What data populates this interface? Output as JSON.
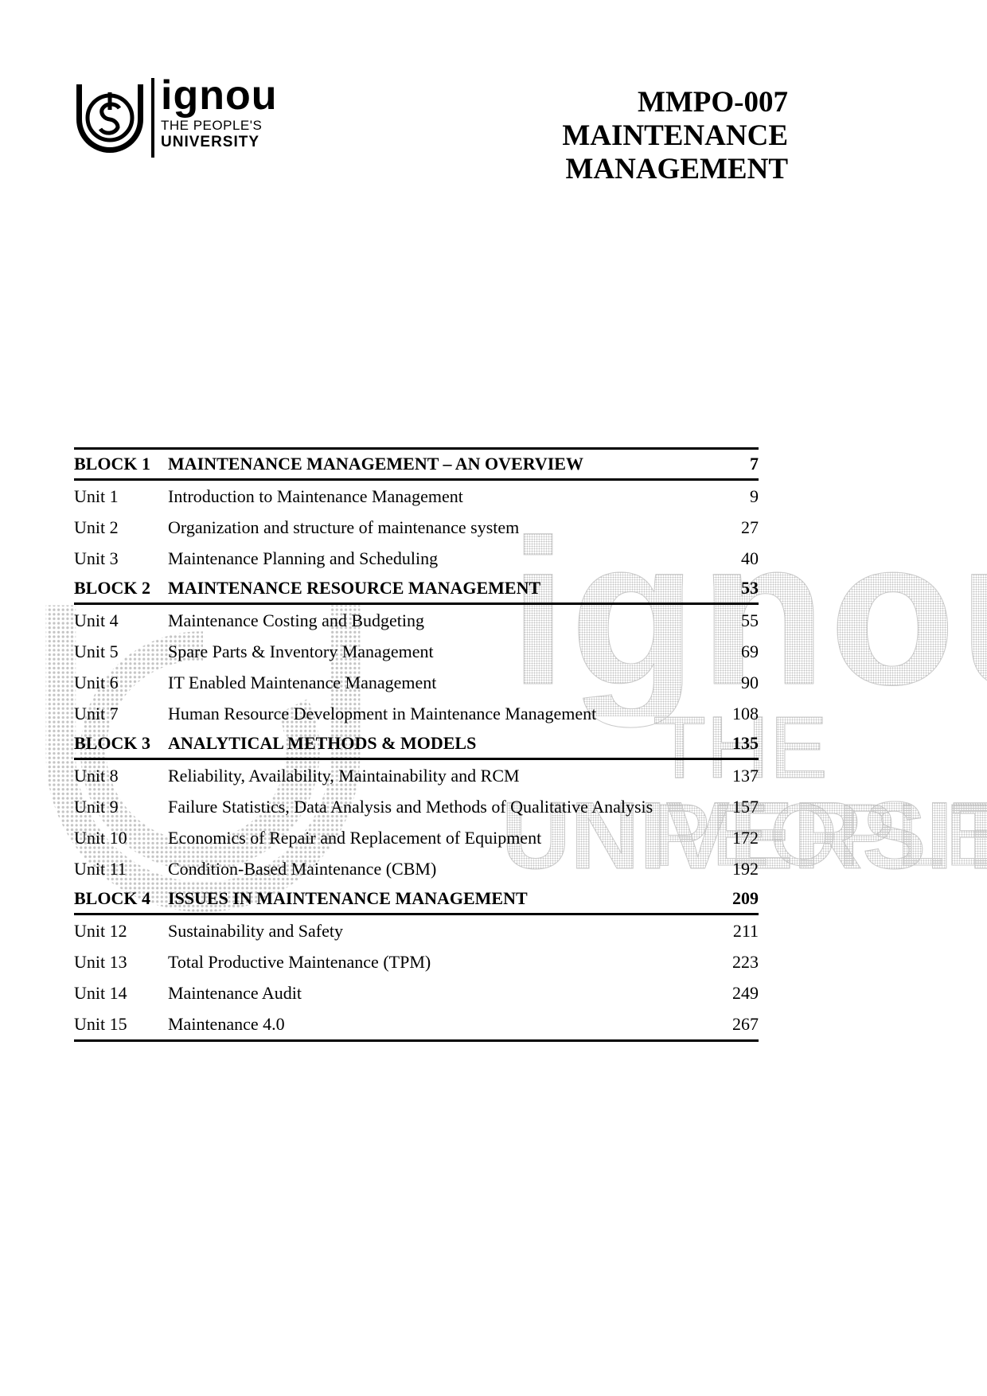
{
  "logo": {
    "wordmark": "ignou",
    "tagline": "THE PEOPLE'S",
    "subline": "UNIVERSITY"
  },
  "title": {
    "code": "MMPO-007",
    "line1": "MAINTENANCE",
    "line2": "MANAGEMENT"
  },
  "watermark": {
    "wordmark": "ignou",
    "tagline": "THE PEOPLE'S",
    "subline": "UNIVERSITY"
  },
  "contents": {
    "blocks": [
      {
        "label": "BLOCK 1",
        "title": "MAINTENANCE MANAGEMENT – AN OVERVIEW",
        "page": "7",
        "units": [
          {
            "label": "Unit 1",
            "title": "Introduction to Maintenance Management",
            "page": "9"
          },
          {
            "label": "Unit 2",
            "title": "Organization and structure of maintenance system",
            "page": "27"
          },
          {
            "label": "Unit 3",
            "title": "Maintenance Planning and Scheduling",
            "page": "40"
          }
        ]
      },
      {
        "label": "BLOCK 2",
        "title": "MAINTENANCE RESOURCE MANAGEMENT",
        "page": "53",
        "units": [
          {
            "label": "Unit 4",
            "title": "Maintenance Costing and Budgeting",
            "page": "55"
          },
          {
            "label": "Unit 5",
            "title": "Spare Parts & Inventory Management",
            "page": "69"
          },
          {
            "label": "Unit 6",
            "title": "IT Enabled Maintenance Management",
            "page": "90"
          },
          {
            "label": "Unit 7",
            "title": "Human Resource Development in Maintenance Management",
            "page": "108"
          }
        ]
      },
      {
        "label": "BLOCK 3",
        "title": "ANALYTICAL METHODS & MODELS",
        "page": "135",
        "units": [
          {
            "label": "Unit 8",
            "title": "Reliability, Availability, Maintainability and RCM",
            "page": "137"
          },
          {
            "label": "Unit 9",
            "title": "Failure Statistics, Data Analysis and Methods of Qualitative Analysis",
            "page": "157"
          },
          {
            "label": "Unit 10",
            "title": "Economics of Repair and Replacement of Equipment",
            "page": "172"
          },
          {
            "label": "Unit 11",
            "title": "Condition-Based Maintenance (CBM)",
            "page": "192"
          }
        ]
      },
      {
        "label": "BLOCK 4",
        "title": "ISSUES IN MAINTENANCE MANAGEMENT",
        "page": "209",
        "units": [
          {
            "label": "Unit 12",
            "title": "Sustainability and Safety",
            "page": "211"
          },
          {
            "label": "Unit 13",
            "title": "Total Productive Maintenance (TPM)",
            "page": "223"
          },
          {
            "label": "Unit 14",
            "title": "Maintenance Audit",
            "page": "249"
          },
          {
            "label": "Unit 15",
            "title": "Maintenance 4.0",
            "page": "267"
          }
        ]
      }
    ]
  }
}
